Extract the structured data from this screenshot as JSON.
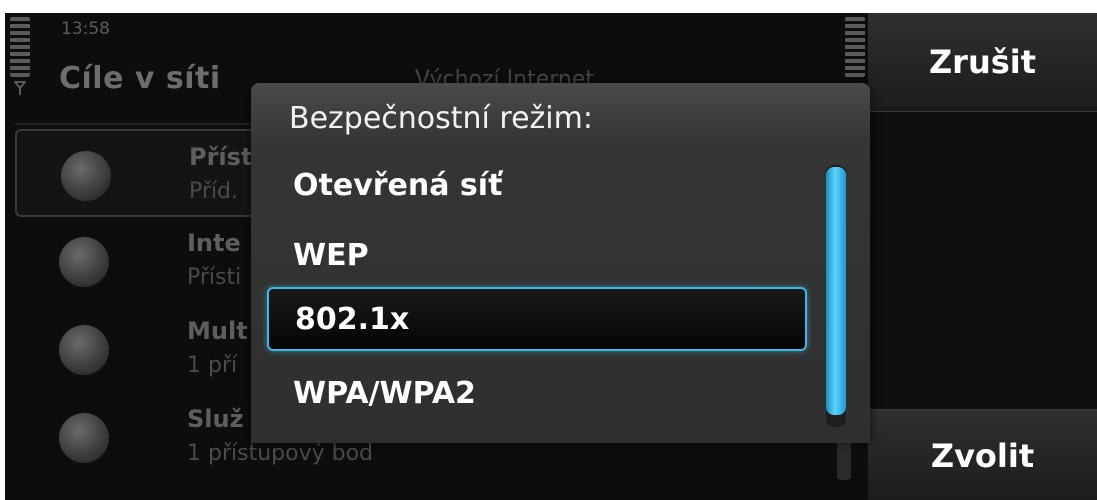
{
  "status_bar": {
    "time": "13:58"
  },
  "background": {
    "title": "Cíle v síti",
    "subtitle": "Výchozí Internet",
    "items": [
      {
        "title": "Příst",
        "subtitle": "Příd.",
        "icon": "compass-icon"
      },
      {
        "title": "Inte",
        "subtitle": "Přísti",
        "icon": "globe-icon"
      },
      {
        "title": "Mult",
        "subtitle": "1 pří",
        "icon": "envelope-icon"
      },
      {
        "title": "Služ",
        "subtitle": "1 přístupový bod",
        "icon": "operator-icon"
      }
    ]
  },
  "dialog": {
    "title": "Bezpečnostní režim:",
    "options": [
      {
        "label": "Otevřená síť",
        "selected": false
      },
      {
        "label": "WEP",
        "selected": false
      },
      {
        "label": "802.1x",
        "selected": true
      },
      {
        "label": "WPA/WPA2",
        "selected": false
      }
    ]
  },
  "softkeys": {
    "top": "Zrušit",
    "bottom": "Zvolit"
  },
  "colors": {
    "accent": "#3fb6e8",
    "dialog_bg": "#353535",
    "softkey_bg": "#262626"
  }
}
